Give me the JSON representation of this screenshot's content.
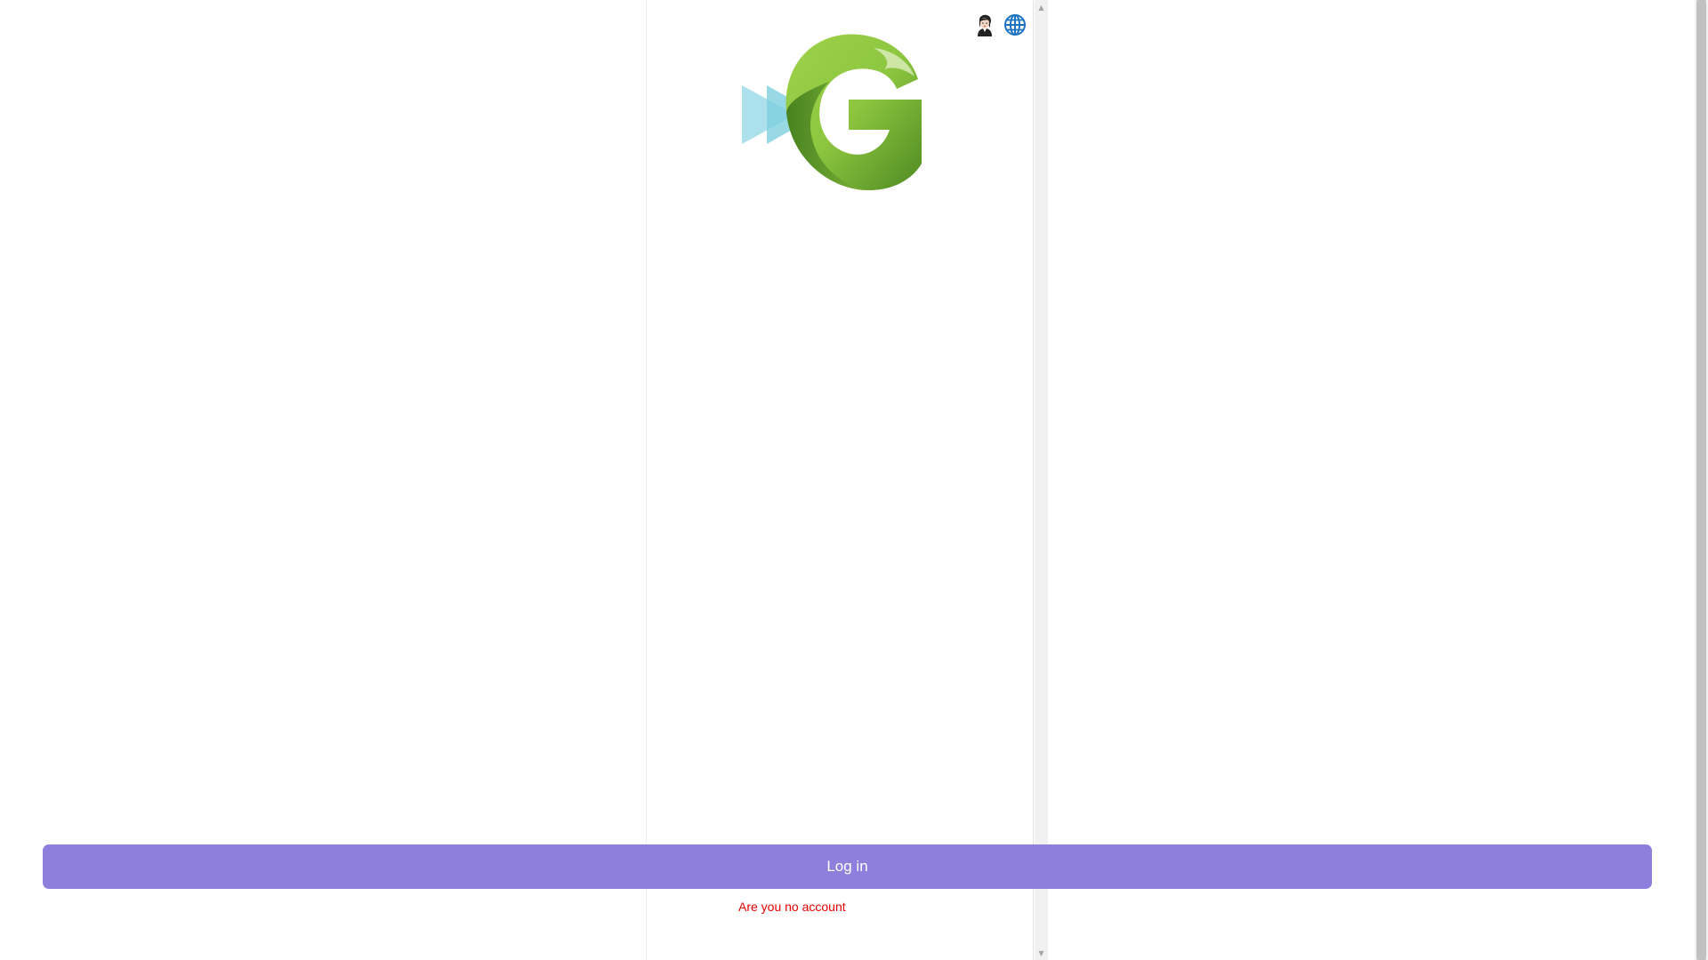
{
  "header": {
    "icons": [
      "user-avatar-icon",
      "globe-icon"
    ]
  },
  "logo": {
    "icon": "logo-icon",
    "colors": {
      "play": "#9ddbe6",
      "g_light": "#8cc63f",
      "g_dark": "#4e8a22"
    }
  },
  "login": {
    "button_label": "Log in",
    "button_color": "#8e7fdc",
    "signup_text": "Are you no account",
    "signup_color": "#e60000"
  }
}
